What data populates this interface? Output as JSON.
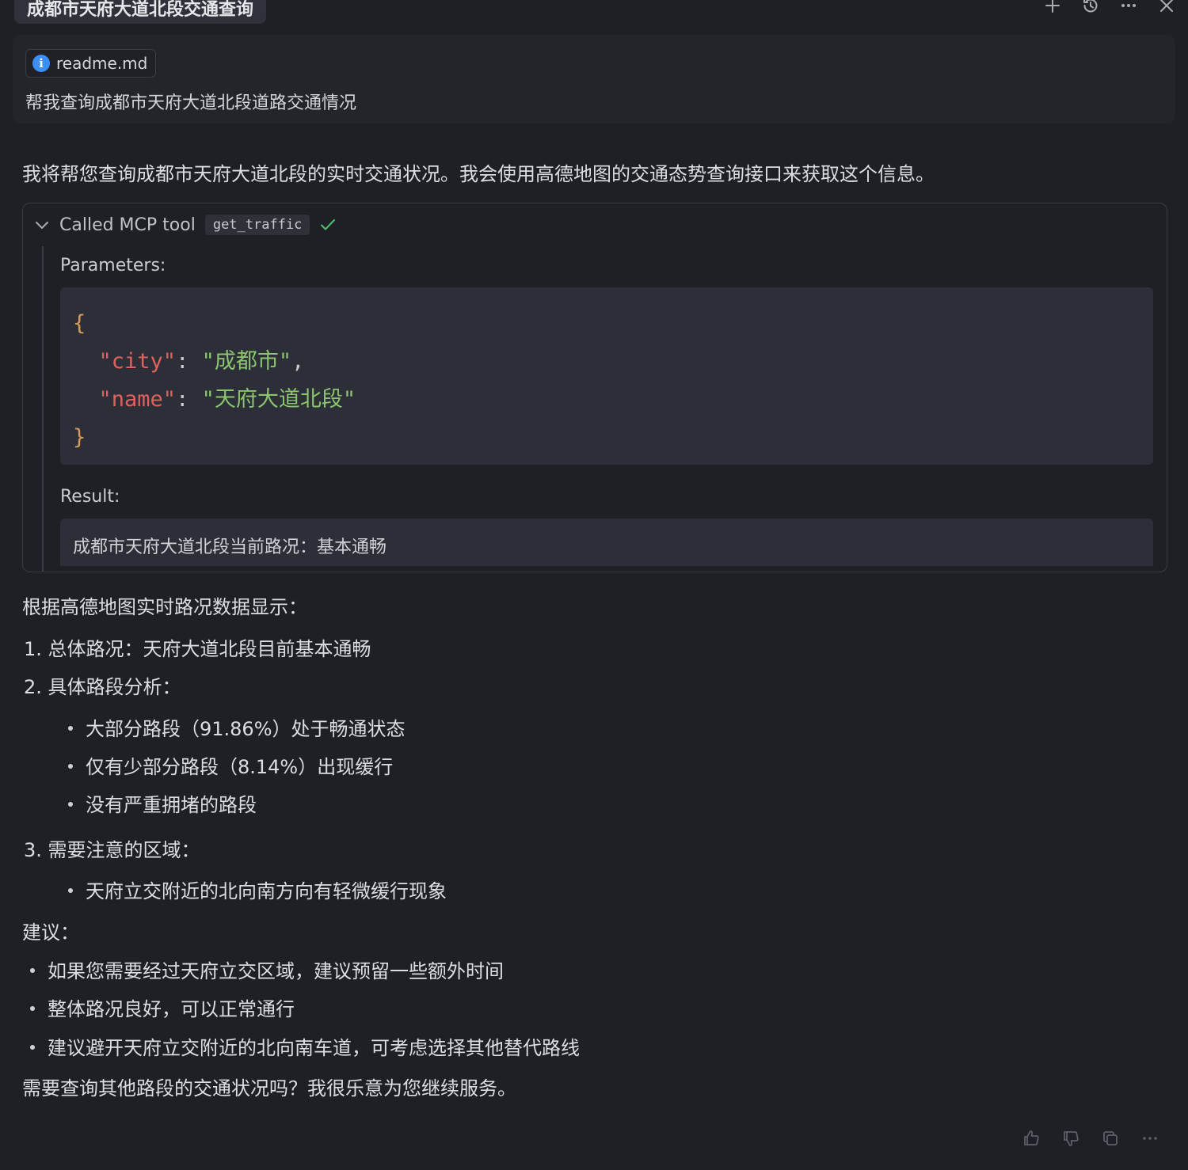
{
  "header": {
    "chat_title": "成都市天府大道北段交通查询",
    "actions": [
      "plus-icon",
      "history-icon",
      "more-icon",
      "close-icon"
    ]
  },
  "user_message": {
    "attachment": "readme.md",
    "text": "帮我查询成都市天府大道北段道路交通情况"
  },
  "assistant": {
    "intro": "我将帮您查询成都市天府大道北段的实时交通状况。我会使用高德地图的交通态势查询接口来获取这个信息。",
    "tool_call": {
      "label": "Called MCP tool",
      "tool_name": "get_traffic",
      "params_label": "Parameters:",
      "params": {
        "open": "{",
        "close": "}",
        "city_key": "\"city\"",
        "city_value": "\"成都市\"",
        "name_key": "\"name\"",
        "name_value": "\"天府大道北段\""
      },
      "result_label": "Result:",
      "result": "成都市天府大道北段当前路况：基本通畅"
    },
    "summary": {
      "heading": "根据高德地图实时路况数据显示：",
      "item1": "1. 总体路况：天府大道北段目前基本通畅",
      "item2": "2. 具体路段分析：",
      "item2_bullets": [
        "大部分路段（91.86%）处于畅通状态",
        "仅有少部分路段（8.14%）出现缓行",
        "没有严重拥堵的路段"
      ],
      "item3": "3. 需要注意的区域：",
      "item3_bullets": [
        "天府立交附近的北向南方向有轻微缓行现象"
      ],
      "advice_heading": "建议：",
      "advice_bullets": [
        "如果您需要经过天府立交区域，建议预留一些额外时间",
        "整体路况良好，可以正常通行",
        "建议避开天府立交附近的北向南车道，可考虑选择其他替代路线"
      ],
      "closing": "需要查询其他路段的交通状况吗？我很乐意为您继续服务。"
    }
  },
  "footer": {
    "actions": [
      "thumbs-up-icon",
      "thumbs-down-icon",
      "copy-icon",
      "more-icon"
    ]
  }
}
